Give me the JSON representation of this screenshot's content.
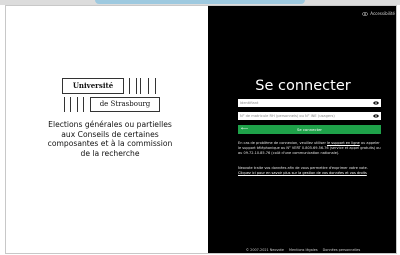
{
  "left": {
    "logo": {
      "line1": "Université",
      "line2": "de Strasbourg"
    },
    "election_title": "Elections générales ou partielles aux Conseils de certaines composantes et à la commission de la recherche"
  },
  "right": {
    "accessibility_label": "Accessibilité",
    "heading": "Se connecter",
    "identifier_placeholder": "Identifiant",
    "password_placeholder": "N° de matricule RH (personnels) ou N° INE (usagers)",
    "submit_label": "Se connecter",
    "help_text_1": "En cas de problème de connexion, veuillez utiliser",
    "help_link_1": "le support en ligne",
    "help_text_1b": "ou appeler le support téléphonique au N° VERT 0.805.69.56.76 (service et appel gratuits) ou au 09.72.10.85.76 (coût d'une communication nationale).",
    "help_text_2": "Neovote traite vos données afin de vous permettre d'exprimer votre vote.",
    "help_link_2": "Cliquez ici pour en savoir plus sur la gestion de vos données et vos droits",
    "footer": {
      "copyright": "© 2007-2021 Neovote",
      "legal": "Mentions légales",
      "privacy": "Données personnelles"
    }
  }
}
